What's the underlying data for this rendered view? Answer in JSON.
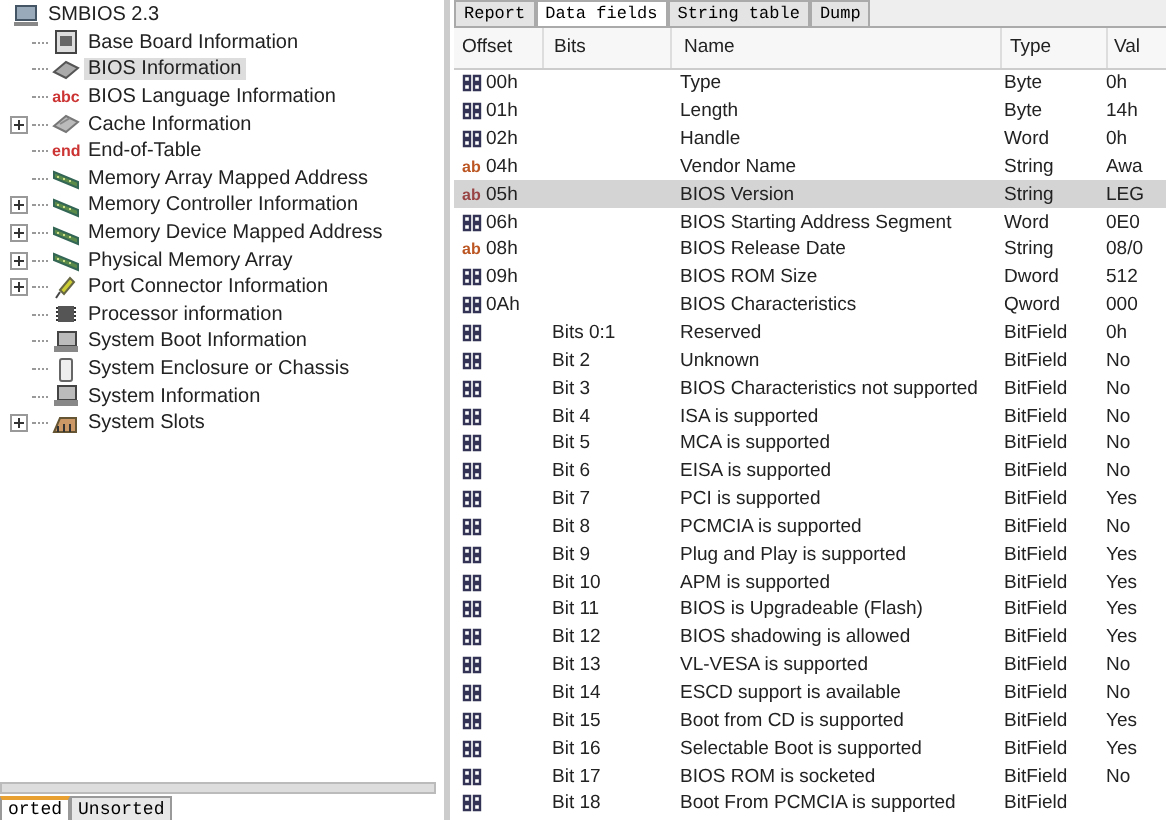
{
  "tree": {
    "root": {
      "label": "SMBIOS 2.3"
    },
    "items": [
      {
        "label": "Base Board Information",
        "kind": "board",
        "expandable": false,
        "selected": false
      },
      {
        "label": "BIOS Information",
        "kind": "chip",
        "expandable": false,
        "selected": true
      },
      {
        "label": "BIOS Language Information",
        "kind": "text",
        "icon_text": "abc",
        "expandable": false,
        "selected": false
      },
      {
        "label": "Cache Information",
        "kind": "cache",
        "expandable": true,
        "selected": false
      },
      {
        "label": "End-of-Table",
        "kind": "text",
        "icon_text": "end",
        "expandable": false,
        "selected": false
      },
      {
        "label": "Memory Array Mapped Address",
        "kind": "memory",
        "expandable": false,
        "selected": false
      },
      {
        "label": "Memory Controller Information",
        "kind": "memory",
        "expandable": true,
        "selected": false
      },
      {
        "label": "Memory Device Mapped Address",
        "kind": "memory",
        "expandable": true,
        "selected": false
      },
      {
        "label": "Physical Memory Array",
        "kind": "memory",
        "expandable": true,
        "selected": false
      },
      {
        "label": "Port Connector Information",
        "kind": "port",
        "expandable": true,
        "selected": false
      },
      {
        "label": "Processor information",
        "kind": "cpu",
        "expandable": false,
        "selected": false
      },
      {
        "label": "System Boot Information",
        "kind": "pc",
        "expandable": false,
        "selected": false
      },
      {
        "label": "System Enclosure or Chassis",
        "kind": "case",
        "expandable": false,
        "selected": false
      },
      {
        "label": "System Information",
        "kind": "pc",
        "expandable": false,
        "selected": false
      },
      {
        "label": "System Slots",
        "kind": "slot",
        "expandable": true,
        "selected": false
      }
    ]
  },
  "left_tabs": [
    {
      "label": "orted",
      "selected": true
    },
    {
      "label": "Unsorted",
      "selected": false
    }
  ],
  "tabs": [
    {
      "label": "Report",
      "selected": false
    },
    {
      "label": "Data fields",
      "selected": true
    },
    {
      "label": "String table",
      "selected": false
    },
    {
      "label": "Dump",
      "selected": false
    }
  ],
  "table": {
    "columns": [
      "Offset",
      "Bits",
      "Name",
      "Type",
      "Val"
    ],
    "rows": [
      {
        "kind": "number",
        "offset": "00h",
        "name": "Type",
        "type": "Byte",
        "value": "0h",
        "selected": false
      },
      {
        "kind": "number",
        "offset": "01h",
        "name": "Length",
        "type": "Byte",
        "value": "14h",
        "selected": false
      },
      {
        "kind": "number",
        "offset": "02h",
        "name": "Handle",
        "type": "Word",
        "value": "0h",
        "selected": false
      },
      {
        "kind": "string",
        "icon_text": "ab",
        "offset": "04h",
        "name": "Vendor Name",
        "type": "String",
        "value": "Awa",
        "selected": false
      },
      {
        "kind": "string",
        "icon_text": "ab",
        "offset": "05h",
        "name": "BIOS Version",
        "type": "String",
        "value": "LEG",
        "selected": true
      },
      {
        "kind": "number",
        "offset": "06h",
        "name": "BIOS Starting Address Segment",
        "type": "Word",
        "value": "0E0",
        "selected": false
      },
      {
        "kind": "string",
        "icon_text": "ab",
        "offset": "08h",
        "name": "BIOS Release Date",
        "type": "String",
        "value": "08/0",
        "selected": false
      },
      {
        "kind": "number",
        "offset": "09h",
        "name": "BIOS ROM Size",
        "type": "Dword",
        "value": "512",
        "selected": false
      },
      {
        "kind": "number",
        "offset": "0Ah",
        "name": "BIOS Characteristics",
        "type": "Qword",
        "value": "000",
        "selected": false
      },
      {
        "kind": "bits",
        "bits": "Bits 0:1",
        "name": "Reserved",
        "type": "BitField",
        "value": "0h",
        "selected": false
      },
      {
        "kind": "bits",
        "bits": "Bit 2",
        "name": "Unknown",
        "type": "BitField",
        "value": "No",
        "selected": false
      },
      {
        "kind": "bits",
        "bits": "Bit 3",
        "name": "BIOS Characteristics not supported",
        "type": "BitField",
        "value": "No",
        "selected": false
      },
      {
        "kind": "bits",
        "bits": "Bit 4",
        "name": "ISA is supported",
        "type": "BitField",
        "value": "No",
        "selected": false
      },
      {
        "kind": "bits",
        "bits": "Bit 5",
        "name": "MCA is supported",
        "type": "BitField",
        "value": "No",
        "selected": false
      },
      {
        "kind": "bits",
        "bits": "Bit 6",
        "name": "EISA is supported",
        "type": "BitField",
        "value": "No",
        "selected": false
      },
      {
        "kind": "bits",
        "bits": "Bit 7",
        "name": "PCI is supported",
        "type": "BitField",
        "value": "Yes",
        "selected": false
      },
      {
        "kind": "bits",
        "bits": "Bit 8",
        "name": "PCMCIA is supported",
        "type": "BitField",
        "value": "No",
        "selected": false
      },
      {
        "kind": "bits",
        "bits": "Bit 9",
        "name": "Plug and Play is supported",
        "type": "BitField",
        "value": "Yes",
        "selected": false
      },
      {
        "kind": "bits",
        "bits": "Bit 10",
        "name": "APM is supported",
        "type": "BitField",
        "value": "Yes",
        "selected": false
      },
      {
        "kind": "bits",
        "bits": "Bit 11",
        "name": "BIOS is Upgradeable (Flash)",
        "type": "BitField",
        "value": "Yes",
        "selected": false
      },
      {
        "kind": "bits",
        "bits": "Bit 12",
        "name": "BIOS shadowing is allowed",
        "type": "BitField",
        "value": "Yes",
        "selected": false
      },
      {
        "kind": "bits",
        "bits": "Bit 13",
        "name": "VL-VESA is supported",
        "type": "BitField",
        "value": "No",
        "selected": false
      },
      {
        "kind": "bits",
        "bits": "Bit 14",
        "name": "ESCD support is available",
        "type": "BitField",
        "value": "No",
        "selected": false
      },
      {
        "kind": "bits",
        "bits": "Bit 15",
        "name": "Boot from CD is supported",
        "type": "BitField",
        "value": "Yes",
        "selected": false
      },
      {
        "kind": "bits",
        "bits": "Bit 16",
        "name": "Selectable Boot is supported",
        "type": "BitField",
        "value": "Yes",
        "selected": false
      },
      {
        "kind": "bits",
        "bits": "Bit 17",
        "name": "BIOS ROM is socketed",
        "type": "BitField",
        "value": "No",
        "selected": false
      },
      {
        "kind": "bits",
        "bits": "Bit 18",
        "name": "Boot From PCMCIA is supported",
        "type": "BitField",
        "selected": false
      }
    ]
  }
}
